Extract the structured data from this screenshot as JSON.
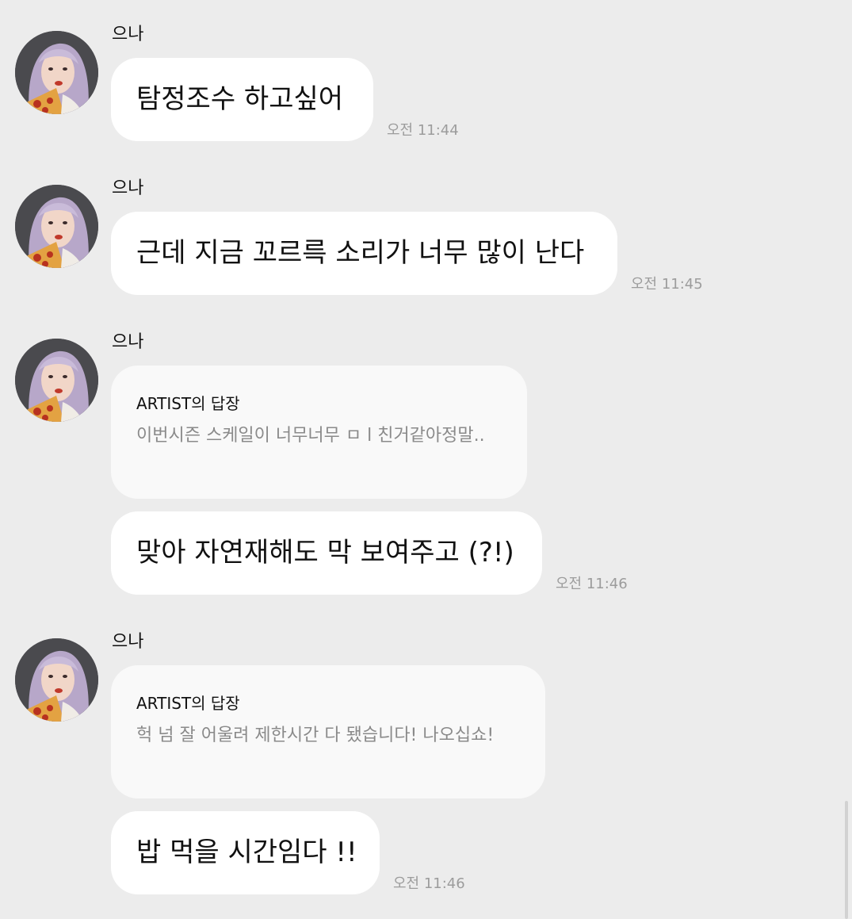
{
  "chat": {
    "groups": [
      {
        "sender": "으나",
        "messages": [
          {
            "text": "탐정조수 하고싶어",
            "time": "오전 11:44"
          }
        ]
      },
      {
        "sender": "으나",
        "messages": [
          {
            "text": "근데 지금 꼬르륵 소리가 너무 많이 난다",
            "time": "오전 11:45"
          }
        ]
      },
      {
        "sender": "으나",
        "reply": {
          "title": "ARTIST의 답장",
          "quote": "이번시즌 스케일이 너무너무 ㅁ l 친거같아정말.."
        },
        "messages": [
          {
            "text": "맞아 자연재해도 막 보여주고 (?!)",
            "time": "오전 11:46"
          }
        ]
      },
      {
        "sender": "으나",
        "reply": {
          "title": "ARTIST의 답장",
          "quote": "헉 넘 잘 어울려 제한시간 다 됐습니다! 나오십쇼!"
        },
        "messages": [
          {
            "text": "밥 먹을 시간임다 !!",
            "time": "오전 11:46"
          }
        ]
      }
    ]
  },
  "avatar_icon": "profile-photo",
  "colors": {
    "background": "#ececec",
    "bubble": "#ffffff",
    "reply_bubble": "#f9f9f9",
    "timestamp": "#9c9c9c",
    "quote_text": "#8a8a8a"
  }
}
